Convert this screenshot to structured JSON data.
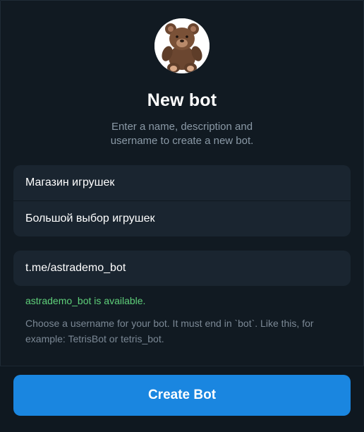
{
  "header": {
    "title": "New bot",
    "subtitle_line1": "Enter a name, description and",
    "subtitle_line2": "username to create a new bot."
  },
  "avatar": {
    "icon": "teddy-bear-icon"
  },
  "form": {
    "name_value": "Магазин игрушек",
    "description_value": "Большой выбор игрушек",
    "username_value": "t.me/astrademo_bot"
  },
  "status": {
    "available_text": "astrademo_bot is available.",
    "available_color": "#5fd07a",
    "hint_text": "Choose a username for your bot. It must end in `bot`. Like this, for example: TetrisBot or tetris_bot."
  },
  "actions": {
    "create_label": "Create Bot",
    "accent_color": "#1a86e0"
  }
}
